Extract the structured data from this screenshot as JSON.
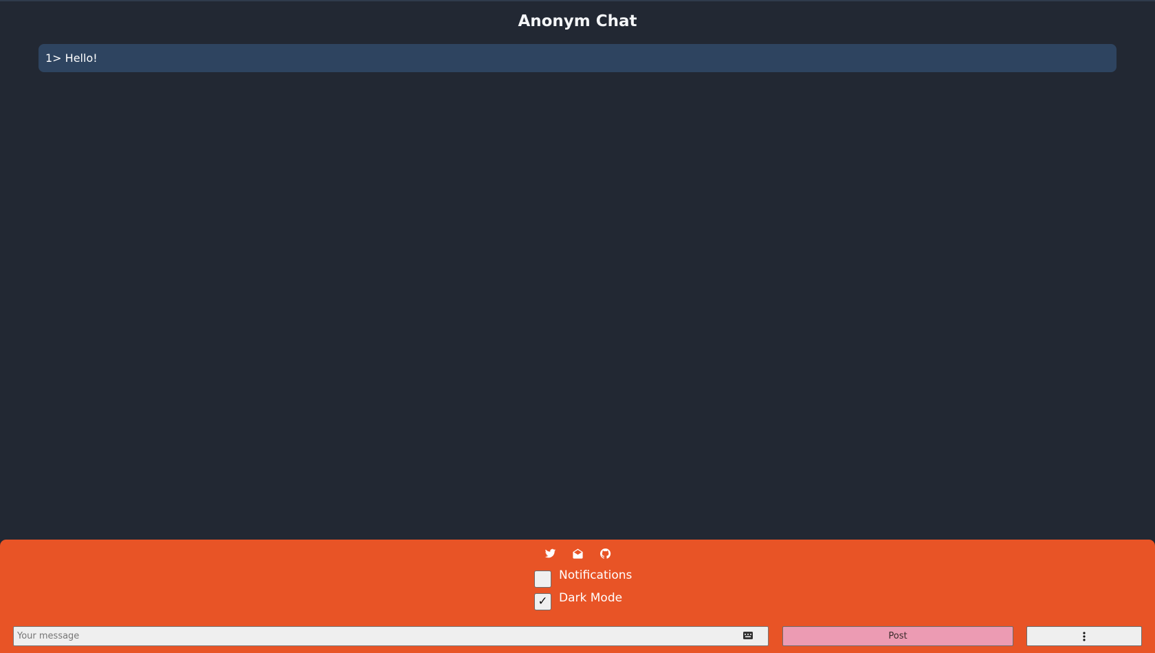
{
  "app": {
    "title": "Anonym Chat"
  },
  "messages": [
    {
      "text": "1> Hello!"
    }
  ],
  "footer": {
    "social_icons": [
      "twitter-icon",
      "mail-icon",
      "github-icon"
    ],
    "toggles": {
      "notifications": {
        "label": "Notifications",
        "checked": false
      },
      "dark_mode": {
        "label": "Dark Mode",
        "checked": true,
        "mark": "✓"
      }
    },
    "compose": {
      "placeholder": "Your message",
      "post_label": "Post",
      "more_icon": "vertical-ellipsis-icon",
      "keyboard_icon": "keyboard-icon"
    }
  },
  "colors": {
    "background": "#222833",
    "message_bg": "#2e4460",
    "footer_bg": "#e85426",
    "post_button": "#ec9bb3"
  }
}
